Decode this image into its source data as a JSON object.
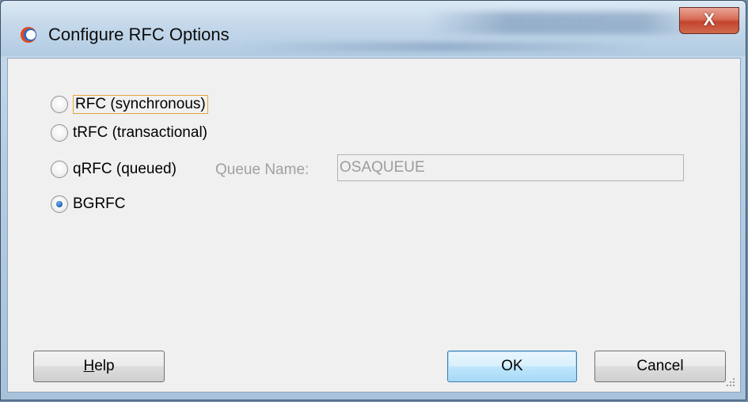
{
  "window": {
    "title": "Configure RFC Options",
    "close_label": "X"
  },
  "options": [
    {
      "label": "RFC (synchronous)",
      "checked": false
    },
    {
      "label": "tRFC (transactional)",
      "checked": false
    },
    {
      "label": "qRFC (queued)",
      "checked": false
    },
    {
      "label": "BGRFC",
      "checked": true
    }
  ],
  "queue": {
    "label": "Queue Name:",
    "value": "OSAQUEUE"
  },
  "buttons": {
    "help_mnemonic": "H",
    "help_rest": "elp",
    "ok": "OK",
    "cancel": "Cancel"
  },
  "colors": {
    "focus_border": "#e5a53b",
    "close_red": "#c2452f",
    "default_button_border": "#3c7fb1"
  }
}
